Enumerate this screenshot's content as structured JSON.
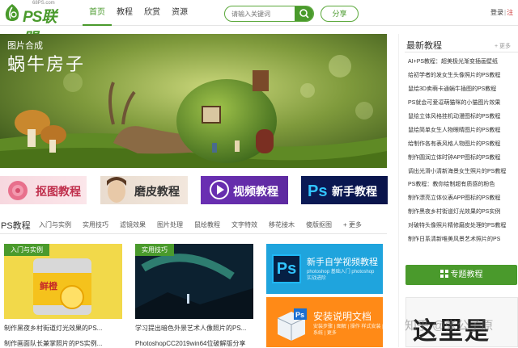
{
  "header": {
    "logo_text": "PS联盟",
    "logo_sub": "68PS.com",
    "nav": [
      "首页",
      "教程",
      "欣赏",
      "资源"
    ],
    "search_placeholder": "请输入关键词",
    "share_label": "分享",
    "login_label": "登录",
    "register_label": "注"
  },
  "banner": {
    "tag": "图片合成",
    "title": "蜗牛房子"
  },
  "tiles": [
    "抠图教程",
    "磨皮教程",
    "视频教程",
    "新手教程"
  ],
  "subnav": {
    "title": "PS教程",
    "items": [
      "入门与实例",
      "实用技巧",
      "滤镜效果",
      "图片处理",
      "鼠绘教程",
      "文字特效",
      "移花接木",
      "傻版抠图",
      "+ 更多"
    ]
  },
  "cards": [
    {
      "tag": "入门与实例",
      "caption": "制作黑夜乡村街道灯光效果的PS...",
      "caption2": "制作画面队长兼掌照片的PS实例..."
    },
    {
      "tag": "实用技巧",
      "caption": "学习提出暗色外景艺术人像照片的PS...",
      "caption2": "PhotoshopCC2019win64位破解版分享"
    }
  ],
  "promos": [
    {
      "logo": "Ps",
      "title": "新手自学视频教程",
      "sub": "photoshop 基础入门 photoshop 实战进阶"
    },
    {
      "title": "安装说明文档",
      "sub": "安装步骤 | 图解 | 操作 样式安装 | 系统 | 更多"
    }
  ],
  "sidebar": {
    "title": "最新教程",
    "more": "+ 更多",
    "items": [
      "AI+PS教程：超美极光渐变插画壁纸",
      "给初学者的发女生头像照片的PS教程",
      "鼠绘3D卖萌卡通蜗牛插图的PS教程",
      "PS就会可爱逗萌猫咪的小猫图片效果",
      "鼠绘立体风格挂机动漫图标的PS教程",
      "鼠绘简单女生人物眼睛图片的PS教程",
      "给制作各有表风格人物图片的PS教程",
      "制作圆润立体时钟APP图标的PS教程",
      "调出光滑小清新海景女生照片的PS教程",
      "PS教程：教你绘制超有质感的粉色",
      "制作漂亮立体仪表APP图标的PS教程",
      "制作黑夜乡村街道灯光效果的PS实例",
      "对破特头像照片精修磨皮处理的PS教程",
      "制作日系清新唯美风景艺术照片的PS"
    ],
    "topic_button": "专题教程",
    "ad_text": "这里是",
    "watermark": "知乎 @张公子原"
  },
  "colors": {
    "accent": "#4a9a2c",
    "promo_blue": "#1fa4dd",
    "promo_orange": "#ff8a17"
  }
}
